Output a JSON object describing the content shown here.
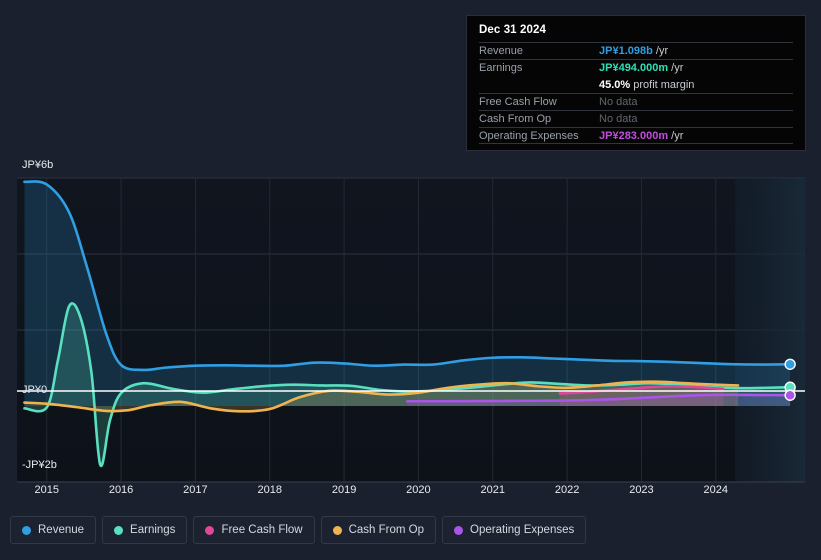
{
  "tooltip": {
    "title": "Dec 31 2024",
    "rows": [
      {
        "label": "Revenue",
        "value": "JP¥1.098b",
        "unit": " /yr",
        "color": "#2f9ee3",
        "nodata": false
      },
      {
        "label": "Earnings",
        "value": "JP¥494.000m",
        "unit": " /yr",
        "color": "#2ee0b5",
        "nodata": false
      },
      {
        "label": "",
        "value": "45.0%",
        "unit": " profit margin",
        "color": "#ffffff",
        "nodata": false
      },
      {
        "label": "Free Cash Flow",
        "value": "No data",
        "unit": "",
        "color": "#61666f",
        "nodata": true
      },
      {
        "label": "Cash From Op",
        "value": "No data",
        "unit": "",
        "color": "#61666f",
        "nodata": true
      },
      {
        "label": "Operating Expenses",
        "value": "JP¥283.000m",
        "unit": " /yr",
        "color": "#c04de0",
        "nodata": false
      }
    ]
  },
  "legend": {
    "items": [
      {
        "label": "Revenue",
        "color": "#2f9ee3"
      },
      {
        "label": "Earnings",
        "color": "#5ae0c0"
      },
      {
        "label": "Free Cash Flow",
        "color": "#e0469a"
      },
      {
        "label": "Cash From Op",
        "color": "#efb44f"
      },
      {
        "label": "Operating Expenses",
        "color": "#a855e8"
      }
    ]
  },
  "chart_data": {
    "type": "area",
    "title": "",
    "xlabel": "",
    "ylabel": "",
    "currency": "JP¥",
    "ylim": [
      -2000000000,
      6000000000
    ],
    "yticks": [
      {
        "value": 6000000000,
        "label": "JP¥6b"
      },
      {
        "value": 4000000000,
        "label": ""
      },
      {
        "value": 2000000000,
        "label": ""
      },
      {
        "value": 0,
        "label": "JP¥0"
      },
      {
        "value": -2000000000,
        "label": "-JP¥2b"
      }
    ],
    "xticks": [
      "2015",
      "2016",
      "2017",
      "2018",
      "2019",
      "2020",
      "2021",
      "2022",
      "2023",
      "2024"
    ],
    "xlim": [
      2014.6,
      2025.2
    ],
    "grid": true,
    "legend_position": "bottom",
    "forecast_start": "2024.0",
    "series": [
      {
        "name": "Revenue",
        "color": "#2f9ee3",
        "x": [
          2014.7,
          2015.0,
          2015.3,
          2015.55,
          2015.8,
          2016.0,
          2016.3,
          2016.6,
          2017.0,
          2017.4,
          2017.8,
          2018.2,
          2018.6,
          2019.0,
          2019.4,
          2019.8,
          2020.2,
          2020.6,
          2021.0,
          2021.4,
          2021.8,
          2022.2,
          2022.6,
          2023.0,
          2023.4,
          2023.8,
          2024.2,
          2024.6,
          2025.0
        ],
        "values": [
          5900000000,
          5830000000,
          5100000000,
          3600000000,
          1900000000,
          1080000000,
          950000000,
          1010000000,
          1060000000,
          1070000000,
          1060000000,
          1060000000,
          1140000000,
          1120000000,
          1060000000,
          1090000000,
          1090000000,
          1200000000,
          1270000000,
          1280000000,
          1250000000,
          1220000000,
          1190000000,
          1180000000,
          1160000000,
          1130000000,
          1100000000,
          1090000000,
          1098000000
        ]
      },
      {
        "name": "Earnings",
        "color": "#5ae0c0",
        "x": [
          2014.7,
          2015.0,
          2015.15,
          2015.3,
          2015.45,
          2015.6,
          2015.72,
          2015.85,
          2016.0,
          2016.3,
          2016.7,
          2017.1,
          2017.5,
          2017.9,
          2018.3,
          2018.7,
          2019.1,
          2019.5,
          2019.9,
          2020.3,
          2020.7,
          2021.1,
          2021.5,
          2021.9,
          2022.3,
          2022.7,
          2023.1,
          2023.5,
          2023.9,
          2024.3,
          2024.7,
          2025.0
        ],
        "values": [
          -60000000,
          -40000000,
          1200000000,
          2620000000,
          2350000000,
          900000000,
          -1550000000,
          -380000000,
          340000000,
          600000000,
          450000000,
          350000000,
          440000000,
          520000000,
          560000000,
          540000000,
          530000000,
          420000000,
          380000000,
          420000000,
          480000000,
          560000000,
          620000000,
          580000000,
          540000000,
          560000000,
          600000000,
          560000000,
          500000000,
          470000000,
          480000000,
          494000000
        ]
      },
      {
        "name": "Free Cash Flow",
        "color": "#e0469a",
        "x": [
          2021.9,
          2022.2,
          2022.6,
          2023.0,
          2023.4,
          2023.8,
          2024.1
        ],
        "values": [
          330000000,
          360000000,
          420000000,
          480000000,
          520000000,
          490000000,
          450000000
        ]
      },
      {
        "name": "Cash From Op",
        "color": "#efb44f",
        "x": [
          2014.7,
          2015.0,
          2015.4,
          2015.8,
          2016.1,
          2016.4,
          2016.8,
          2017.2,
          2017.6,
          2018.0,
          2018.4,
          2018.8,
          2019.2,
          2019.6,
          2020.0,
          2020.4,
          2020.8,
          2021.2,
          2021.6,
          2022.0,
          2022.4,
          2022.8,
          2023.2,
          2023.6,
          2024.0,
          2024.3
        ],
        "values": [
          90000000,
          60000000,
          -30000000,
          -130000000,
          -110000000,
          20000000,
          110000000,
          -60000000,
          -140000000,
          -80000000,
          230000000,
          400000000,
          370000000,
          300000000,
          350000000,
          480000000,
          560000000,
          600000000,
          520000000,
          480000000,
          540000000,
          620000000,
          640000000,
          600000000,
          560000000,
          540000000
        ]
      },
      {
        "name": "Operating Expenses",
        "color": "#a855e8",
        "x": [
          2019.85,
          2020.2,
          2020.6,
          2021.0,
          2021.4,
          2021.8,
          2022.2,
          2022.6,
          2023.0,
          2023.4,
          2023.8,
          2024.2,
          2024.6,
          2025.0
        ],
        "values": [
          125000000,
          125000000,
          128000000,
          130000000,
          135000000,
          140000000,
          150000000,
          175000000,
          215000000,
          255000000,
          285000000,
          295000000,
          288000000,
          283000000
        ]
      }
    ]
  }
}
